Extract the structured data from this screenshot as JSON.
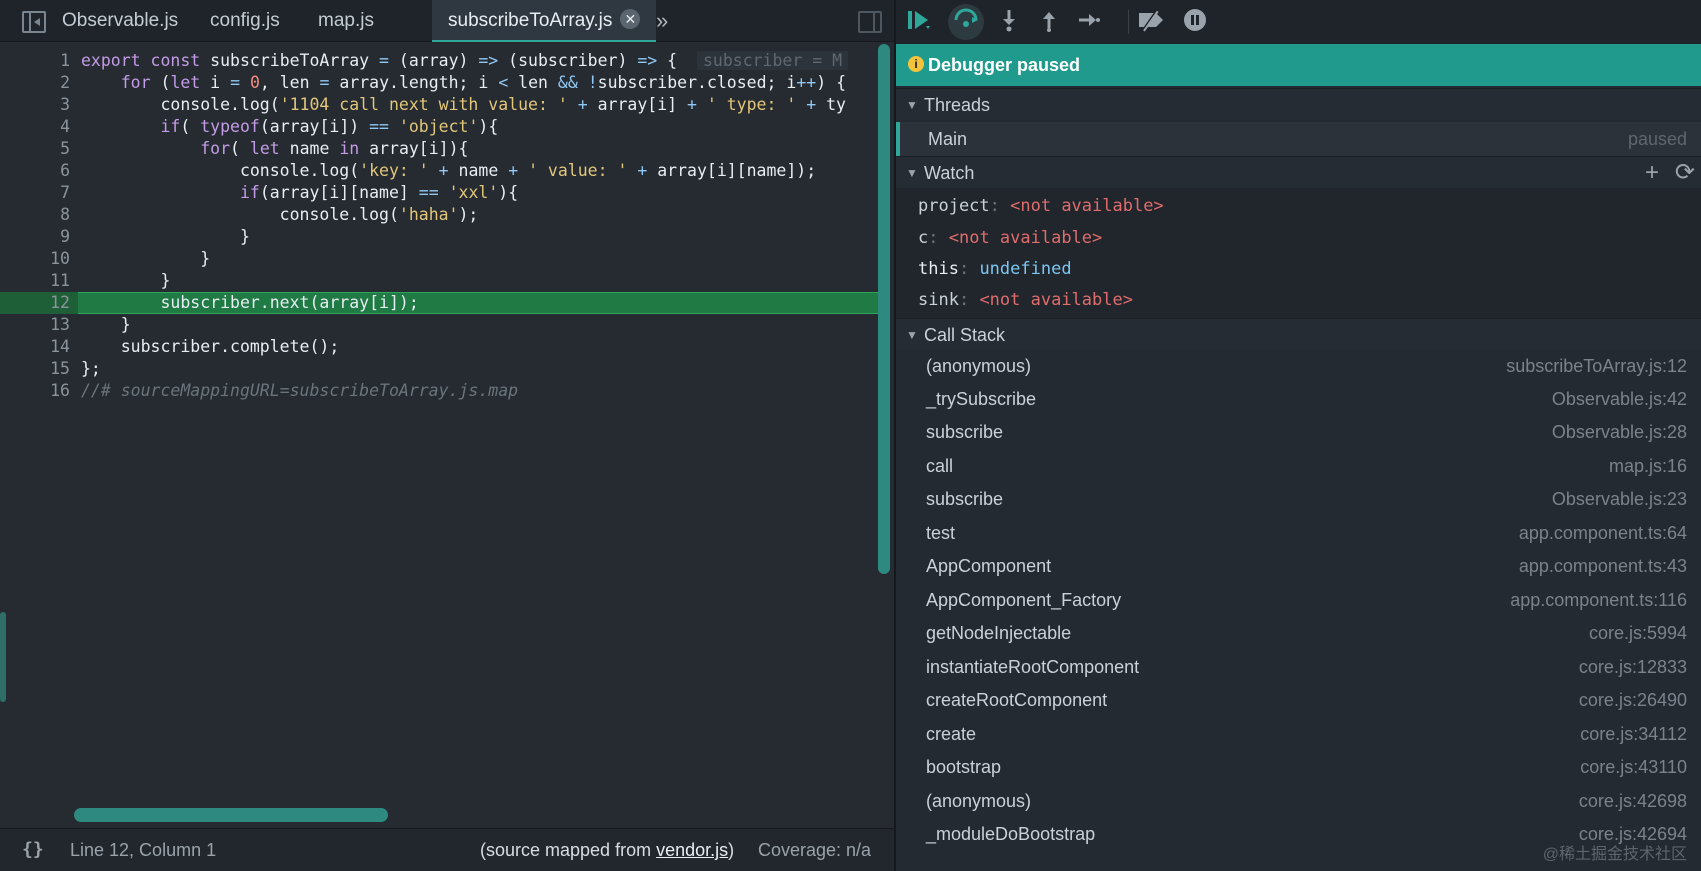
{
  "editor": {
    "tabs": [
      {
        "label": "Observable.js"
      },
      {
        "label": "config.js"
      },
      {
        "label": "map.js"
      },
      {
        "label": "subscribeToArray.js",
        "active": true
      }
    ],
    "tab_close": "✕",
    "tab_more": "»",
    "lines": [
      {
        "n": "1"
      },
      {
        "n": "2"
      },
      {
        "n": "3"
      },
      {
        "n": "4"
      },
      {
        "n": "5"
      },
      {
        "n": "6"
      },
      {
        "n": "7"
      },
      {
        "n": "8"
      },
      {
        "n": "9"
      },
      {
        "n": "10"
      },
      {
        "n": "11"
      },
      {
        "n": "12"
      },
      {
        "n": "13"
      },
      {
        "n": "14"
      },
      {
        "n": "15"
      },
      {
        "n": "16"
      }
    ],
    "inline_hint": "subscriber = M",
    "status": {
      "pretty": "{}",
      "position": "Line 12, Column 1",
      "mapped_prefix": "(source mapped from ",
      "mapped_link": "vendor.js",
      "mapped_suffix": ")",
      "coverage": "Coverage: n/a"
    }
  },
  "debugger": {
    "paused_label": "Debugger paused",
    "info_icon": "i",
    "threads": {
      "title": "Threads",
      "items": [
        {
          "name": "Main",
          "state": "paused"
        }
      ]
    },
    "watch": {
      "title": "Watch",
      "add_icon": "+",
      "refresh_icon": "⟳",
      "items": [
        {
          "name": "project",
          "value": "<not available>"
        },
        {
          "name": "c",
          "value": "<not available>"
        },
        {
          "name": "this",
          "value": "undefined"
        },
        {
          "name": "sink",
          "value": "<not available>"
        }
      ]
    },
    "call_stack": {
      "title": "Call Stack",
      "frames": [
        {
          "fn": "(anonymous)",
          "loc": "subscribeToArray.js:12"
        },
        {
          "fn": "_trySubscribe",
          "loc": "Observable.js:42"
        },
        {
          "fn": "subscribe",
          "loc": "Observable.js:28"
        },
        {
          "fn": "call",
          "loc": "map.js:16"
        },
        {
          "fn": "subscribe",
          "loc": "Observable.js:23"
        },
        {
          "fn": "test",
          "loc": "app.component.ts:64"
        },
        {
          "fn": "AppComponent",
          "loc": "app.component.ts:43"
        },
        {
          "fn": "AppComponent_Factory",
          "loc": "app.component.ts:116"
        },
        {
          "fn": "getNodeInjectable",
          "loc": "core.js:5994"
        },
        {
          "fn": "instantiateRootComponent",
          "loc": "core.js:12833"
        },
        {
          "fn": "createRootComponent",
          "loc": "core.js:26490"
        },
        {
          "fn": "create",
          "loc": "core.js:34112"
        },
        {
          "fn": "bootstrap",
          "loc": "core.js:43110"
        },
        {
          "fn": "(anonymous)",
          "loc": "core.js:42698"
        },
        {
          "fn": "_moduleDoBootstrap",
          "loc": "core.js:42694"
        }
      ]
    }
  },
  "watermark": "@稀土掘金技术社区"
}
